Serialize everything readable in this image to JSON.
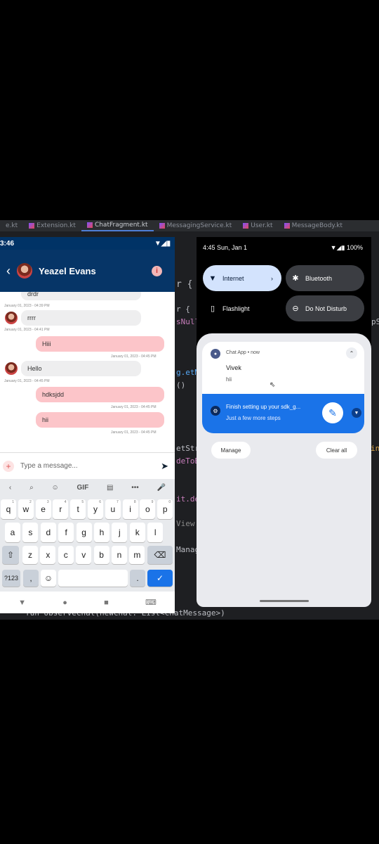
{
  "ide": {
    "tabs": [
      "e.kt",
      "Extension.kt",
      "ChatFragment.kt",
      "MessagingService.kt",
      "User.kt",
      "MessageBody.kt"
    ],
    "code_fragments": [
      "r { f",
      "r {",
      "sNull",
      "g.etM",
      "()",
      "etStr",
      "deToB",
      "it.de",
      "View",
      "Manag",
      "in",
      "pS",
      "fun observeChat(newChat: List<ChatMessage>)"
    ]
  },
  "left_phone": {
    "status_time": "3:46",
    "header": {
      "back": "‹",
      "contact_name": "Yeazel Evans",
      "info": "i"
    },
    "messages": [
      {
        "side": "recv",
        "text": "drdr",
        "time": "January 01, 2023 - 04:39 PM"
      },
      {
        "side": "recv",
        "text": "rrrr",
        "time": "January 01, 2023 - 04:41 PM"
      },
      {
        "side": "sent",
        "text": "Hiii",
        "time": "January 01, 2023 - 04:45 PM"
      },
      {
        "side": "recv",
        "text": "Hello",
        "time": "January 01, 2023 - 04:45 PM"
      },
      {
        "side": "sent",
        "text": "hdksjdd",
        "time": "January 01, 2023 - 04:45 PM"
      },
      {
        "side": "sent",
        "text": "hii",
        "time": "January 01, 2023 - 04:45 PM"
      }
    ],
    "input": {
      "placeholder": "Type a message..."
    },
    "keyboard": {
      "tools": [
        "‹",
        "⌕",
        "☺",
        "GIF",
        "▤",
        "•••",
        "🎤"
      ],
      "row1": [
        "q",
        "w",
        "e",
        "r",
        "t",
        "y",
        "u",
        "i",
        "o",
        "p"
      ],
      "row1_nums": [
        "1",
        "2",
        "3",
        "4",
        "5",
        "6",
        "7",
        "8",
        "9",
        "0"
      ],
      "row2": [
        "a",
        "s",
        "d",
        "f",
        "g",
        "h",
        "j",
        "k",
        "l"
      ],
      "row3": [
        "z",
        "x",
        "c",
        "v",
        "b",
        "n",
        "m"
      ],
      "symbols_key": "?123",
      "comma": ",",
      "period": "."
    }
  },
  "right_phone": {
    "status": {
      "time_date": "4:45 Sun, Jan 1",
      "battery": "100%"
    },
    "quick_settings": [
      {
        "label": "Internet",
        "state": "on"
      },
      {
        "label": "Bluetooth",
        "state": "off"
      },
      {
        "label": "Flashlight",
        "state": "off"
      },
      {
        "label": "Do Not Disturb",
        "state": "off"
      }
    ],
    "notification": {
      "app": "Chat App • now",
      "title": "Vivek",
      "body": "hii"
    },
    "setup_card": {
      "title": "Finish setting up your sdk_g...",
      "subtitle": "Just a few more steps"
    },
    "manage_label": "Manage",
    "clear_all_label": "Clear all"
  },
  "colors": {
    "header_bg": "#063567",
    "sent_bubble": "#fcc5c9",
    "recv_bubble": "#eeeeef",
    "accent_blue": "#1a73e8",
    "qs_on": "#d3e3fd"
  }
}
